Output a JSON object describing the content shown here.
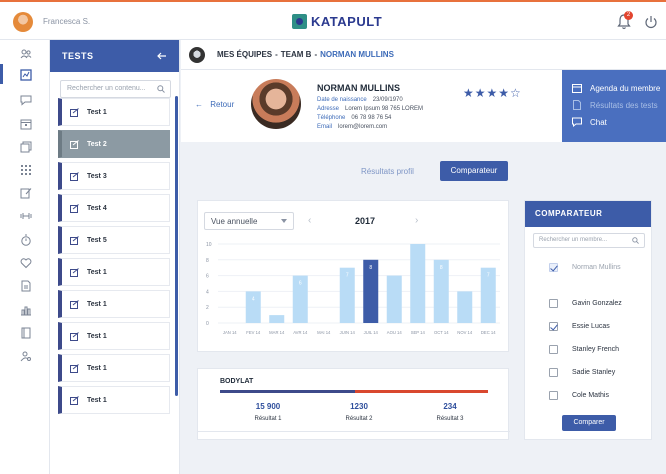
{
  "header": {
    "user_name": "Francesca S.",
    "brand": "KATAPULT",
    "notification_count": "2"
  },
  "rail": {
    "icons": [
      "users-icon",
      "dashboard-icon",
      "chat-icon",
      "calendar-icon",
      "layers-icon",
      "grid-icon",
      "edit-icon",
      "training-icon",
      "timer-icon",
      "heart-icon",
      "report-icon",
      "bar-chart-icon",
      "document-icon",
      "user-search-icon"
    ]
  },
  "tests": {
    "title": "TESTS",
    "search_placeholder": "Rechercher un contenu...",
    "items": [
      "Test 1",
      "Test 2",
      "Test 3",
      "Test 4",
      "Test 5",
      "Test 1",
      "Test 1",
      "Test 1",
      "Test 1",
      "Test 1"
    ]
  },
  "breadcrumb": {
    "section": "MES ÉQUIPES",
    "team": "TEAM B",
    "current": "NORMAN MULLINS"
  },
  "profile": {
    "back_label": "Retour",
    "name": "NORMAN MULLINS",
    "fields": [
      {
        "label": "Date de naissance",
        "value": "23/09/1970"
      },
      {
        "label": "Adresse",
        "value": "Lorem Ipsum 98 765 LOREM"
      },
      {
        "label": "Téléphone",
        "value": "06 78 98 76 54"
      },
      {
        "label": "Email",
        "value": "lorem@lorem.com"
      }
    ],
    "stars": "★★★★☆",
    "rating": 4
  },
  "actions": {
    "items": [
      "Agenda du membre",
      "Résultats des tests",
      "Chat"
    ]
  },
  "view_tabs": {
    "profile_results": "Résultats profil",
    "comparator": "Comparateur"
  },
  "chart": {
    "select_value": "Vue annuelle",
    "prev": "‹",
    "next": "›",
    "year": "2017"
  },
  "chart_data": {
    "type": "bar",
    "categories": [
      "JAN 14",
      "FEV 14",
      "MAR 14",
      "AVR 14",
      "MAI 14",
      "JUIN 14",
      "JUIL 14",
      "AOU 14",
      "SEP 14",
      "OCT 14",
      "NOV 14",
      "DEC 14"
    ],
    "values": [
      0,
      4,
      1,
      6,
      0,
      7,
      8,
      6,
      10,
      8,
      4,
      7
    ],
    "data_labels": [
      "",
      "4",
      "",
      "6",
      "",
      "7",
      "8",
      "",
      "",
      "8",
      "",
      "7"
    ],
    "highlight_index": 6,
    "yticks": [
      "10",
      "8",
      "6",
      "4",
      "2",
      "0"
    ],
    "ylim": [
      0,
      10
    ],
    "title": "",
    "xlabel": "",
    "ylabel": "",
    "colors": {
      "bar": "#b9dcf6",
      "highlight": "#3d5ca8",
      "grid": "#eef1f6"
    }
  },
  "comparateur": {
    "title": "COMPARATEUR",
    "search_placeholder": "Rechercher un membre...",
    "self": "Norman Mullins",
    "members": [
      {
        "name": "Gavin Gonzalez",
        "checked": false
      },
      {
        "name": "Essie Lucas",
        "checked": true
      },
      {
        "name": "Stanley French",
        "checked": false
      },
      {
        "name": "Sadie Stanley",
        "checked": false
      },
      {
        "name": "Cole Mathis",
        "checked": false
      }
    ],
    "button": "Comparer"
  },
  "bodylat": {
    "title": "BODYLAT",
    "results": [
      {
        "value": "15 900",
        "label": "Résultat 1"
      },
      {
        "value": "1230",
        "label": "Résultat 2"
      },
      {
        "value": "234",
        "label": "Résultat 3"
      }
    ]
  }
}
